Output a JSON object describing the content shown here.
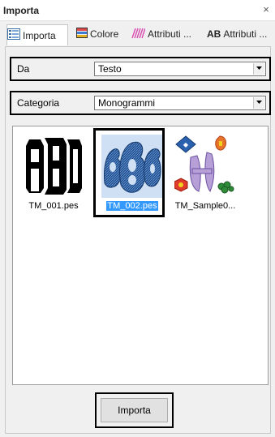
{
  "window": {
    "title": "Importa",
    "close_glyph": "×"
  },
  "tabs": [
    {
      "label": "Importa",
      "icon": "import-grid-icon",
      "active": true
    },
    {
      "label": "Colore",
      "icon": "color-icon",
      "active": false
    },
    {
      "label": "Attributi ...",
      "icon": "stitch-attributes-icon",
      "active": false
    },
    {
      "label": "Attributi ...",
      "icon": "text-attributes-icon",
      "icon_text": "AB",
      "active": false
    }
  ],
  "source": {
    "label": "Da",
    "value": "Testo"
  },
  "category": {
    "label": "Categoria",
    "value": "Monogrammi"
  },
  "files": [
    {
      "name": "TM_001.pes",
      "selected": false
    },
    {
      "name": "TM_002.pes",
      "selected": true
    },
    {
      "name": "TM_Sample0...",
      "selected": false
    }
  ],
  "actions": {
    "import_label": "Importa"
  },
  "colors": {
    "selection": "#3399ff",
    "monogram_blue": "#1f4f8f",
    "tab_color_icon": "#e04848",
    "stripe_icon": "#d84bb0"
  }
}
